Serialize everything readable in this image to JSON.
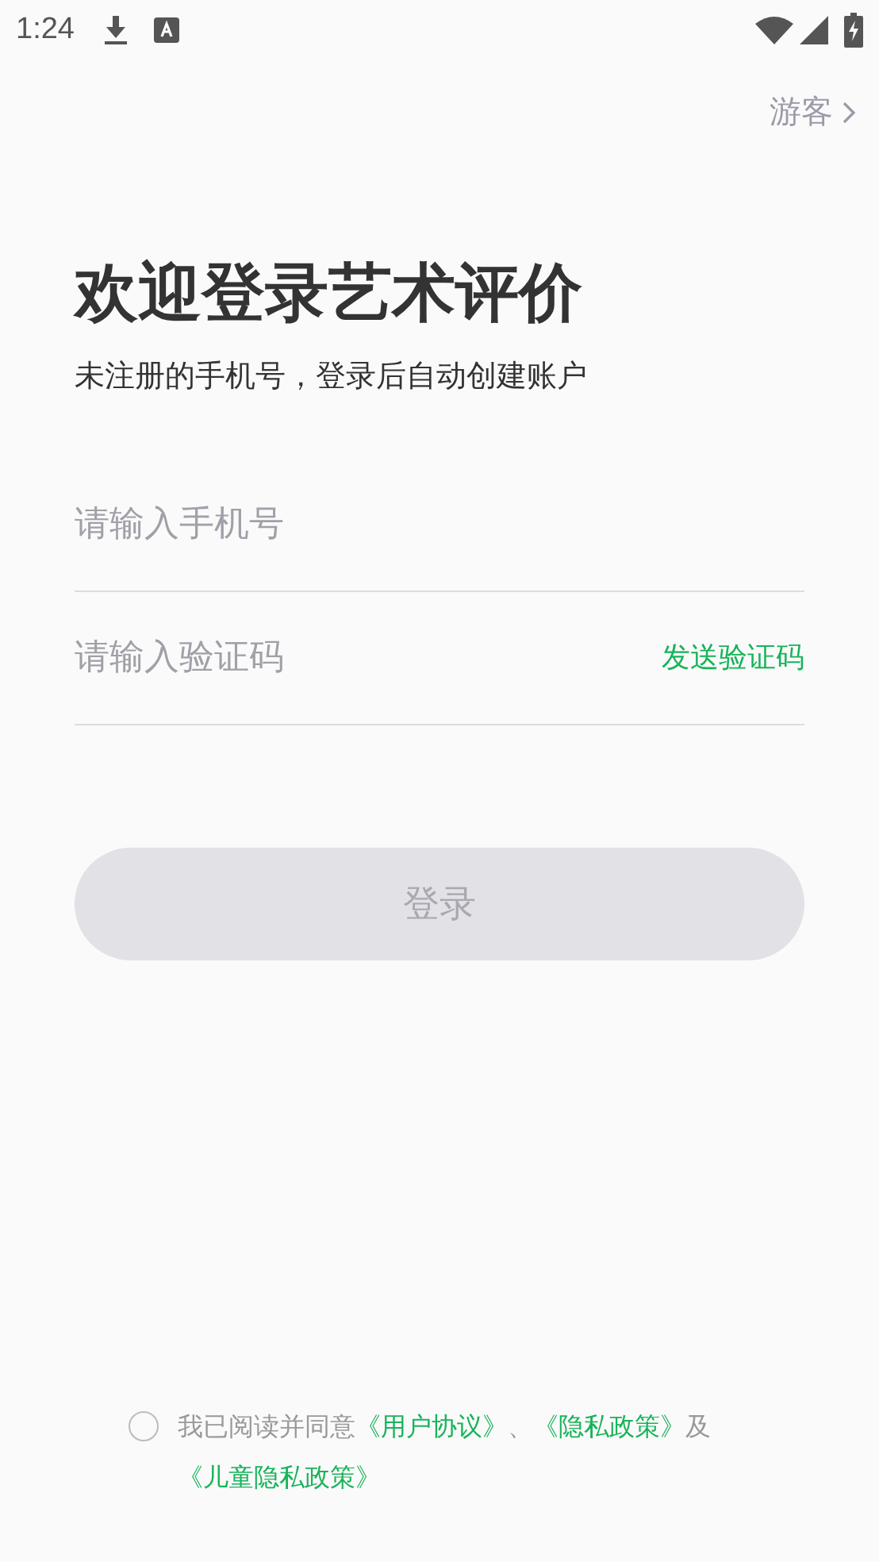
{
  "status_bar": {
    "time": "1:24"
  },
  "guest_link": {
    "label": "游客"
  },
  "title": "欢迎登录艺术评价",
  "subtitle": "未注册的手机号，登录后自动创建账户",
  "phone_field": {
    "placeholder": "请输入手机号"
  },
  "code_field": {
    "placeholder": "请输入验证码",
    "action": "发送验证码"
  },
  "login_button": {
    "label": "登录",
    "disabled": true
  },
  "agreement": {
    "checked": false,
    "parts": [
      {
        "kind": "text",
        "text": "我已阅读并同意"
      },
      {
        "kind": "link",
        "text": "《用户协议》"
      },
      {
        "kind": "text",
        "text": "、"
      },
      {
        "kind": "link",
        "text": "《隐私政策》"
      },
      {
        "kind": "text",
        "text": "及"
      },
      {
        "kind": "link",
        "text": "《儿童隐私政策》"
      }
    ]
  }
}
